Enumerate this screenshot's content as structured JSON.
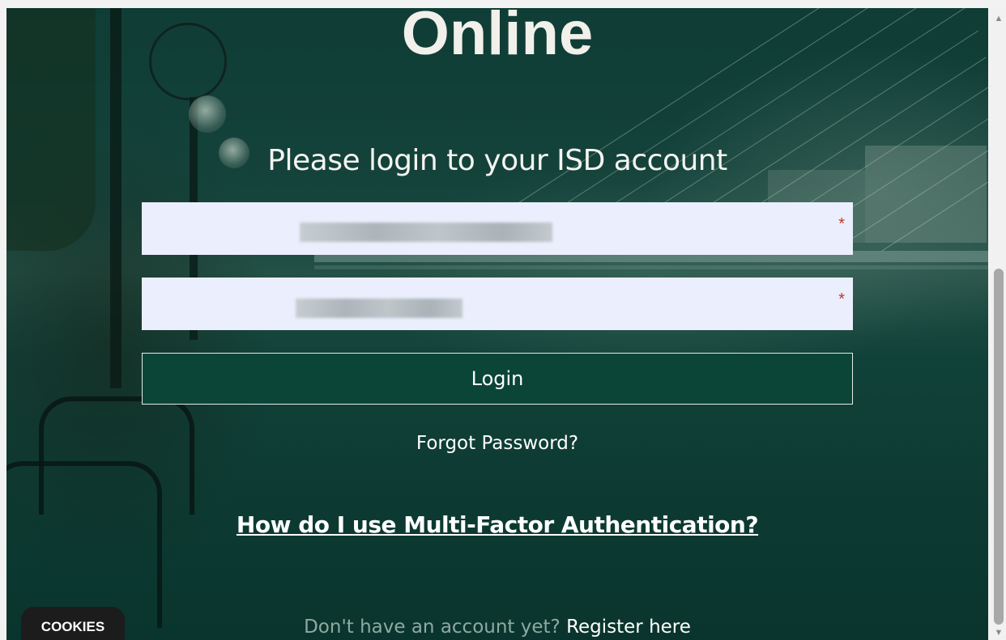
{
  "page": {
    "heading": "Online",
    "subtitle": "Please login to your ISD account"
  },
  "form": {
    "email_field": {
      "value": "",
      "required_marker": "*"
    },
    "password_field": {
      "value": "",
      "required_marker": "*"
    },
    "login_label": "Login"
  },
  "links": {
    "forgot_password": "Forgot Password?",
    "mfa_help": "How do I use Multi-Factor Authentication?",
    "register_prompt": "Don't have an account yet?",
    "register_link": "Register here"
  },
  "cookies": {
    "label": "COOKIES"
  },
  "scrollbar": {
    "up_icon": "scroll-up-arrow",
    "down_icon": "scroll-down-arrow"
  },
  "colors": {
    "overlay": "#0a4538",
    "field_bg": "#ebeefc",
    "required": "#c0392b",
    "cookie_bg": "#1c1c1c"
  }
}
